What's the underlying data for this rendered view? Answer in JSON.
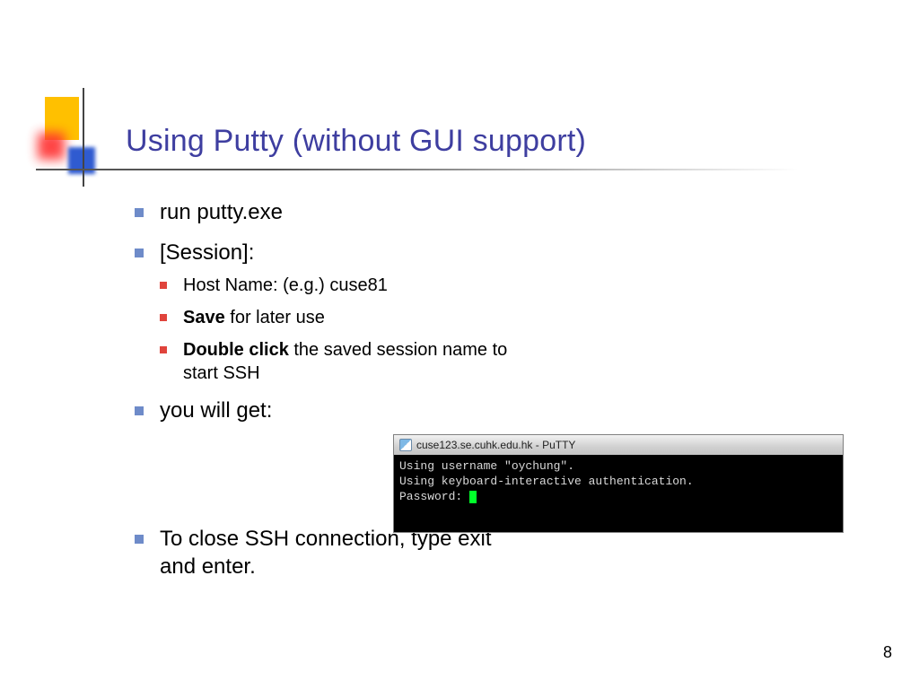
{
  "slide": {
    "title": "Using Putty (without GUI support)",
    "page_number": "8"
  },
  "bullets": {
    "b1": "run putty.exe",
    "b2": "[Session]:",
    "sub1": "Host Name: (e.g.) cuse81",
    "sub2_bold": "Save",
    "sub2_rest": " for later use",
    "sub3_bold": "Double click",
    "sub3_rest": " the saved session name to start SSH",
    "b3": "you will get:",
    "b4": "To close SSH connection, type exit and enter."
  },
  "terminal": {
    "window_title": "cuse123.se.cuhk.edu.hk - PuTTY",
    "line1": "Using username \"oychung\".",
    "line2": "Using keyboard-interactive authentication.",
    "line3": "Password: "
  }
}
